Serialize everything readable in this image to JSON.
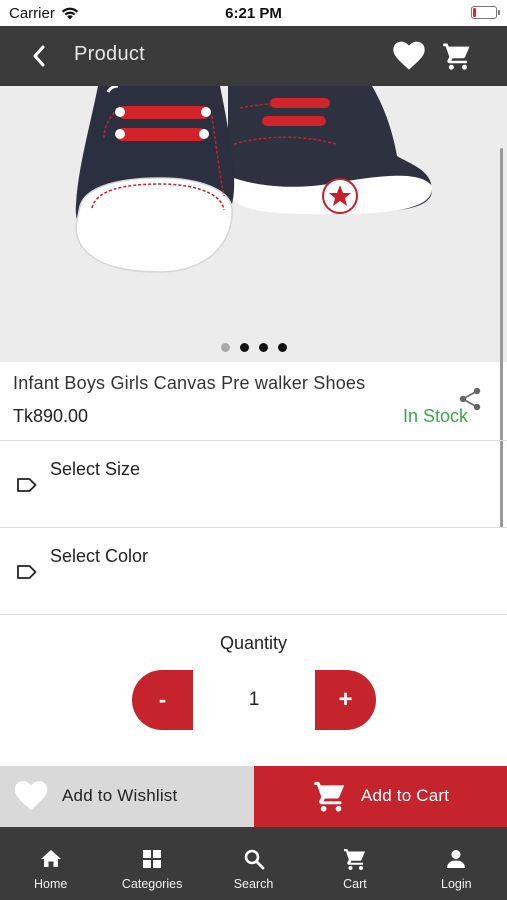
{
  "status_bar": {
    "carrier": "Carrier",
    "time": "6:21 PM"
  },
  "header": {
    "title": "Product",
    "back_icon": "chevron-left-icon",
    "favorite_icon": "heart-icon",
    "cart_icon": "cart-icon"
  },
  "product": {
    "name": "Infant Boys Girls Canvas Pre walker Shoes",
    "price": "Tk890.00",
    "stock": "In Stock",
    "stock_color": "#3aa64a",
    "image_dots": {
      "count": 4,
      "active_index": 0
    }
  },
  "options": {
    "size_label": "Select Size",
    "color_label": "Select Color"
  },
  "quantity": {
    "title": "Quantity",
    "minus": "-",
    "value": "1",
    "plus": "+"
  },
  "actions": {
    "wishlist_label": "Add to Wishlist",
    "cart_label": "Add to Cart"
  },
  "bottom_nav": [
    {
      "label": "Home",
      "icon": "home-icon"
    },
    {
      "label": "Categories",
      "icon": "grid-icon"
    },
    {
      "label": "Search",
      "icon": "search-icon"
    },
    {
      "label": "Cart",
      "icon": "cart-icon"
    },
    {
      "label": "Login",
      "icon": "person-icon"
    }
  ],
  "colors": {
    "brand_red": "#c5242c",
    "appbar": "#3b3b3b",
    "wishlist_bg": "#d9d9d9"
  }
}
